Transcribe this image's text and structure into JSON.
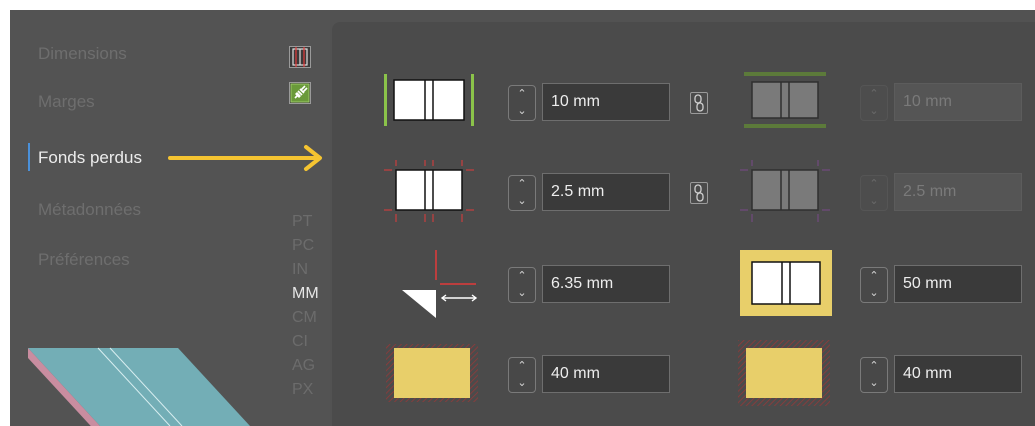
{
  "sidebar": {
    "items": [
      {
        "label": "Dimensions"
      },
      {
        "label": "Marges"
      },
      {
        "label": "Fonds perdus"
      },
      {
        "label": "Métadonnées"
      },
      {
        "label": "Préférences"
      }
    ],
    "active_item": "Fonds perdus",
    "units": [
      "PT",
      "PC",
      "IN",
      "MM",
      "CM",
      "CI",
      "AG",
      "PX"
    ],
    "active_unit": "MM",
    "accent_color": "#4a90d9"
  },
  "annotation": {
    "arrow_color": "#f5c431"
  },
  "fields": {
    "row1_left": "10 mm",
    "row1_right": "10 mm",
    "row2_left": "2.5 mm",
    "row2_right": "2.5 mm",
    "row3_left": "6.35 mm",
    "row3_right": "50 mm",
    "row4_left": "40 mm",
    "row4_right": "40 mm"
  },
  "colors": {
    "green": "#8bc34a",
    "yellow": "#e8cf6a",
    "red": "#e23b3b"
  }
}
